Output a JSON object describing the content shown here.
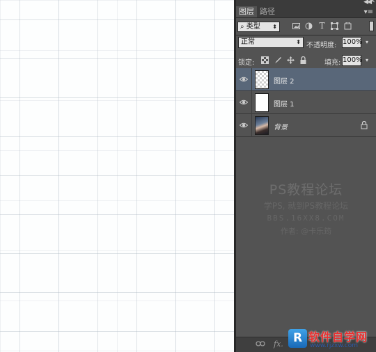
{
  "panel": {
    "tabs": [
      {
        "label": "图层",
        "active": true
      },
      {
        "label": "路径",
        "active": false
      }
    ]
  },
  "filter": {
    "kind_label": "类型",
    "icons": [
      "image-filter-icon",
      "adjustment-filter-icon",
      "type-filter-icon",
      "shape-filter-icon",
      "smart-object-filter-icon"
    ]
  },
  "blend": {
    "mode": "正常",
    "opacity_label": "不透明度:",
    "opacity_value": "100%"
  },
  "lock": {
    "label": "锁定:",
    "fill_label": "填充:",
    "fill_value": "100%"
  },
  "layers": [
    {
      "name": "图层 2",
      "selected": true,
      "thumb": "transparent"
    },
    {
      "name": "图层 1",
      "selected": false,
      "thumb": "white"
    },
    {
      "name": "背景",
      "selected": false,
      "thumb": "photo",
      "locked": true
    }
  ],
  "watermark": {
    "line1": "PS教程论坛",
    "line2": "学PS, 就到PS教程论坛",
    "line3": "BBS.16XX8.COM",
    "line4": "作者: @卡乐筠"
  },
  "bottom": {
    "fx_label": "fx."
  },
  "logo": {
    "badge": "R",
    "name": "软件自学网",
    "url": "www.rjzxw.com"
  }
}
